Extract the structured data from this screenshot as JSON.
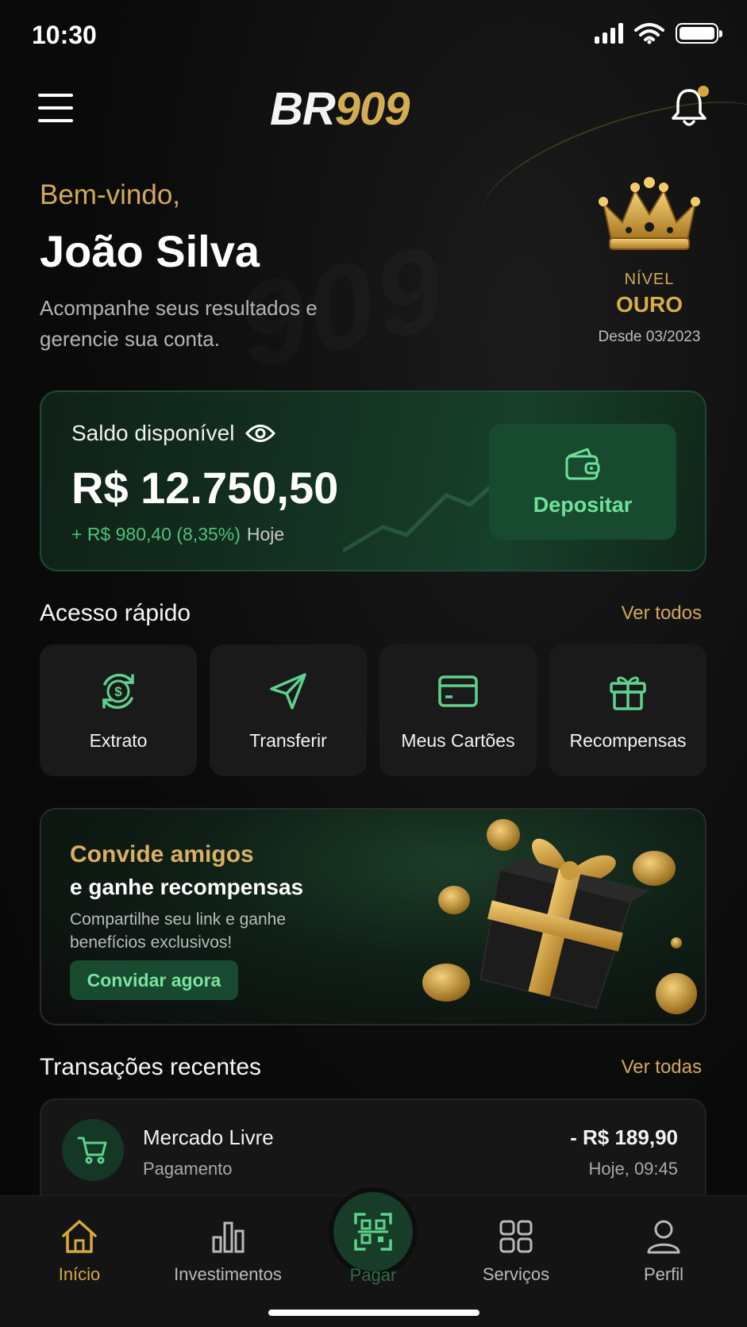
{
  "status_bar": {
    "time": "10:30"
  },
  "header": {
    "logo_br": "BR",
    "logo_num": "909"
  },
  "welcome": {
    "greeting": "Bem-vindo,",
    "name": "João Silva",
    "subtitle": "Acompanhe seus resultados e gerencie sua conta."
  },
  "level": {
    "label": "NÍVEL",
    "tier": "OURO",
    "since": "Desde 03/2023"
  },
  "balance": {
    "label": "Saldo disponível",
    "amount": "R$ 12.750,50",
    "change": "+ R$ 980,40 (8,35%)",
    "period": "Hoje",
    "deposit_label": "Depositar"
  },
  "quick_access": {
    "title": "Acesso rápido",
    "see_all": "Ver todos",
    "items": [
      {
        "label": "Extrato",
        "icon": "dollar-cycle-icon"
      },
      {
        "label": "Transferir",
        "icon": "send-icon"
      },
      {
        "label": "Meus Cartões",
        "icon": "card-icon"
      },
      {
        "label": "Recompensas",
        "icon": "gift-icon"
      }
    ]
  },
  "referral": {
    "title_line1": "Convide amigos",
    "title_line2": "e ganhe recompensas",
    "description": "Compartilhe seu link e ganhe benefícios exclusivos!",
    "button": "Convidar agora"
  },
  "transactions": {
    "title": "Transações recentes",
    "see_all": "Ver todas",
    "items": [
      {
        "name": "Mercado Livre",
        "type": "Pagamento",
        "amount": "- R$ 189,90",
        "time": "Hoje, 09:45",
        "icon": "cart-icon"
      }
    ]
  },
  "bottom_nav": {
    "items": [
      {
        "label": "Início",
        "icon": "home-icon",
        "active": true
      },
      {
        "label": "Investimentos",
        "icon": "bar-chart-icon",
        "active": false
      },
      {
        "label": "Pagar",
        "icon": "qr-scan-icon",
        "active": false
      },
      {
        "label": "Serviços",
        "icon": "grid-icon",
        "active": false
      },
      {
        "label": "Perfil",
        "icon": "user-icon",
        "active": false
      }
    ]
  },
  "colors": {
    "gold": "#d2a956",
    "green_accent": "#6fe09a",
    "positive": "#4fc07a",
    "background": "#0a0a0a"
  }
}
